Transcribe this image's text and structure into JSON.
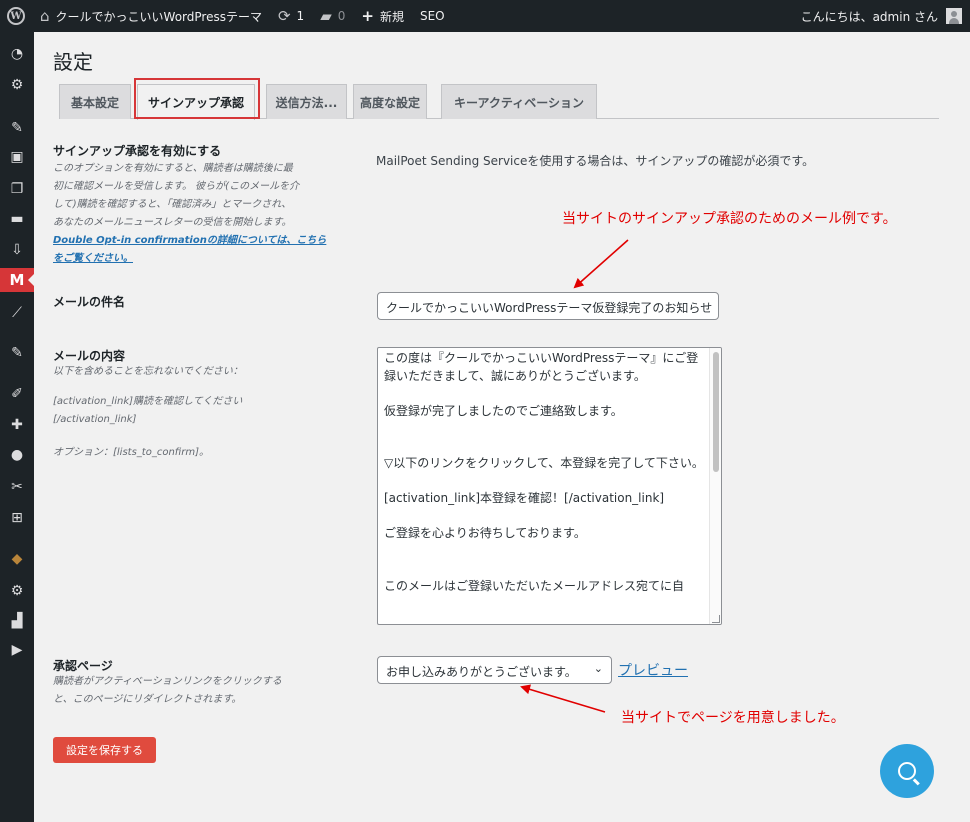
{
  "adminbar": {
    "site_name": "クールでかっこいいWordPressテーマ",
    "updates_count": "1",
    "comments_count": "0",
    "new_label": "新規",
    "seo_label": "SEO",
    "greeting": "こんにちは、admin さん"
  },
  "page": {
    "title": "設定"
  },
  "tabs": [
    {
      "label": "基本設定"
    },
    {
      "label": "サインアップ承認"
    },
    {
      "label": "送信方法..."
    },
    {
      "label": "高度な設定"
    },
    {
      "label": "キーアクティベーション"
    }
  ],
  "settings": {
    "optin": {
      "label": "サインアップ承認を有効にする",
      "desc_lines": [
        "このオプションを有効にすると、購読者は購読後に最",
        "初に確認メールを受信します。 彼らが(このメールを介",
        "して)購読を確認すると、「確認済み」とマークされ、",
        "あなたのメールニュースレターの受信を開始します。"
      ],
      "link_lines": [
        "Double Opt-in confirmationの詳細については、こちら",
        "をご覧ください。"
      ],
      "info": "MailPoet Sending Serviceを使用する場合は、サインアップの確認が必須です。"
    },
    "subject": {
      "label": "メールの件名",
      "value": "クールでかっこいいWordPressテーマ仮登録完了のお知らせ"
    },
    "body": {
      "label": "メールの内容",
      "desc_line1": "以下を含めることを忘れないでください：",
      "desc_line2": "[activation_link]購読を確認してください",
      "desc_line3": "[/activation_link]",
      "desc_line4": "オプション：[lists_to_confirm]。",
      "value": "この度は『クールでかっこいいWordPressテーマ』にご登録いただきまして、誠にありがとうございます。\n\n仮登録が完了しましたのでご連絡致します。\n\n\n▽以下のリンクをクリックして、本登録を完了して下さい。\n\n[activation_link]本登録を確認！[/activation_link]\n\nご登録を心よりお待ちしております。\n\n\nこのメールはご登録いただいたメールアドレス宛てに自"
    },
    "confirm_page": {
      "label": "承認ページ",
      "desc_line1": "購読者がアクティベーションリンクをクリックする",
      "desc_line2": "と、このページにリダイレクトされます。",
      "selected": "お申し込みありがとうございます。",
      "preview_label": "プレビュー"
    },
    "save_label": "設定を保存する"
  },
  "annotations": {
    "email_example": "当サイトのサインアップ承認のためのメール例です。",
    "page_prepared": "当サイトでページを用意しました。",
    "color": "#e10000"
  },
  "colors": {
    "adminbar": "#1d2327",
    "active_menu": "#d63638",
    "link": "#2271b1",
    "save_button": "#e04b3e",
    "help_fab": "#2ea2dd"
  }
}
